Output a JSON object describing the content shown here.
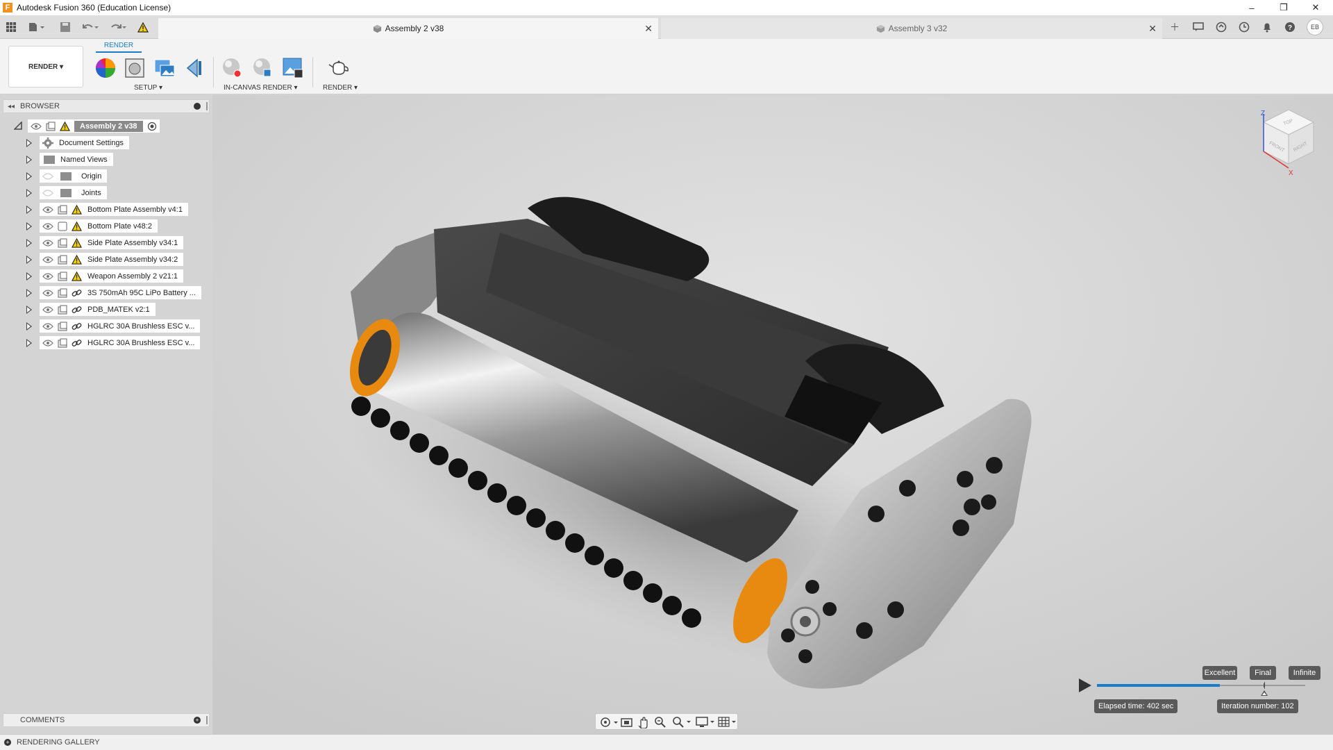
{
  "window": {
    "title": "Autodesk Fusion 360 (Education License)",
    "app_logo": "F",
    "minimize": "–",
    "maximize": "❐",
    "close": "✕"
  },
  "tabs": [
    {
      "label": "Assembly 2 v38",
      "active": true,
      "close": "✕"
    },
    {
      "label": "Assembly 3 v32",
      "active": false,
      "close": "✕"
    }
  ],
  "user": {
    "initials": "EB"
  },
  "ribbon": {
    "active_tab": "RENDER",
    "workspace": "RENDER ▾",
    "groups": {
      "setup": "SETUP ▾",
      "in_canvas": "IN-CANVAS RENDER ▾",
      "render": "RENDER ▾"
    }
  },
  "browser": {
    "title": "BROWSER",
    "root": "Assembly 2 v38",
    "items": [
      {
        "label": "Document Settings",
        "icon": "gear-icon"
      },
      {
        "label": "Named Views",
        "icon": "folder-icon"
      },
      {
        "label": "Origin",
        "icon": "folder-icon"
      },
      {
        "label": "Joints",
        "icon": "folder-icon"
      },
      {
        "label": "Bottom Plate Assembly v4:1",
        "icon": "warning-icon"
      },
      {
        "label": "Bottom Plate v48:2",
        "icon": "warning-icon"
      },
      {
        "label": "Side Plate Assembly v34:1",
        "icon": "warning-icon"
      },
      {
        "label": "Side Plate Assembly v34:2",
        "icon": "warning-icon"
      },
      {
        "label": "Weapon Assembly 2 v21:1",
        "icon": "warning-icon"
      },
      {
        "label": "3S 750mAh 95C LiPo Battery ...",
        "icon": "link-icon"
      },
      {
        "label": "PDB_MATEK v2:1",
        "icon": "link-icon"
      },
      {
        "label": "HGLRC 30A  Brushless ESC v...",
        "icon": "link-icon"
      },
      {
        "label": "HGLRC 30A  Brushless ESC v...",
        "icon": "link-icon"
      }
    ]
  },
  "comments": {
    "title": "COMMENTS"
  },
  "gallery": {
    "title": "RENDERING GALLERY"
  },
  "viewcube": {
    "top": "TOP",
    "front": "FRONT",
    "right": "RIGHT",
    "axis_z": "Z",
    "axis_x": "X"
  },
  "render": {
    "quality_levels": [
      "Excellent",
      "Final",
      "Infinite"
    ],
    "progress_fraction": 0.59,
    "elapsed": "Elapsed time: 402 sec",
    "iteration": "Iteration number: 102"
  },
  "colors": {
    "accent": "#1a7bc7",
    "warning": "#f5d000",
    "orange": "#e88a10"
  }
}
